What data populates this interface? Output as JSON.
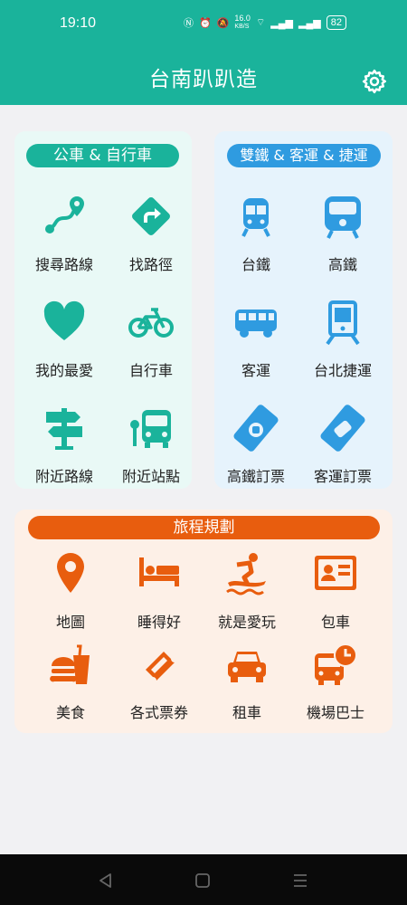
{
  "status": {
    "time": "19:10",
    "net_speed": "16.0",
    "net_unit": "KB/S",
    "battery": "82"
  },
  "header": {
    "title": "台南趴趴造"
  },
  "bus_section": {
    "title": "公車 & 自行車",
    "items": [
      {
        "label": "搜尋路線",
        "icon": "route-icon"
      },
      {
        "label": "找路徑",
        "icon": "directions-icon"
      },
      {
        "label": "我的最愛",
        "icon": "heart-icon"
      },
      {
        "label": "自行車",
        "icon": "bicycle-icon"
      },
      {
        "label": "附近路線",
        "icon": "signpost-icon"
      },
      {
        "label": "附近站點",
        "icon": "bus-stop-icon"
      }
    ]
  },
  "rail_section": {
    "title": "雙鐵 & 客運 & 捷運",
    "items": [
      {
        "label": "台鐵",
        "icon": "train-icon"
      },
      {
        "label": "高鐵",
        "icon": "hsr-icon"
      },
      {
        "label": "客運",
        "icon": "coach-icon"
      },
      {
        "label": "台北捷運",
        "icon": "metro-icon"
      },
      {
        "label": "高鐵訂票",
        "icon": "train-ticket-icon"
      },
      {
        "label": "客運訂票",
        "icon": "bus-ticket-icon"
      }
    ]
  },
  "trip_section": {
    "title": "旅程規劃",
    "items": [
      {
        "label": "地圖",
        "icon": "map-pin-icon"
      },
      {
        "label": "睡得好",
        "icon": "bed-icon"
      },
      {
        "label": "就是愛玩",
        "icon": "surfing-icon"
      },
      {
        "label": "包車",
        "icon": "id-card-icon"
      },
      {
        "label": "美食",
        "icon": "food-icon"
      },
      {
        "label": "各式票券",
        "icon": "ticket-icon"
      },
      {
        "label": "租車",
        "icon": "car-icon"
      },
      {
        "label": "機場巴士",
        "icon": "airport-bus-icon"
      }
    ]
  },
  "colors": {
    "primary": "#1ab39b",
    "rail": "#2f9be0",
    "trip": "#e85d0e"
  }
}
